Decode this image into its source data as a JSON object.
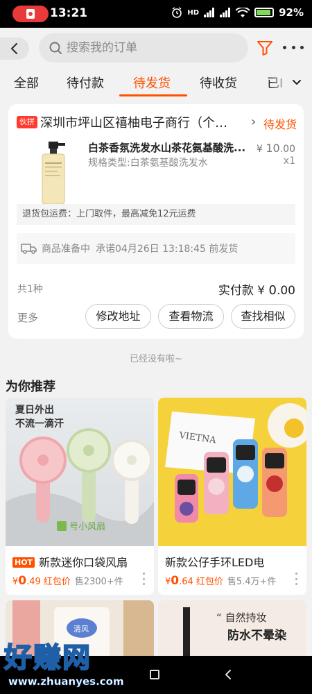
{
  "status_bar": {
    "time": "13:21",
    "signal_label": "HD",
    "battery_percent": "92%",
    "battery_level": 0.92
  },
  "header": {
    "search_placeholder": "搜索我的订单"
  },
  "tabs": [
    {
      "label": "全部",
      "active": false
    },
    {
      "label": "待付款",
      "active": false
    },
    {
      "label": "待发货",
      "active": true
    },
    {
      "label": "待收货",
      "active": false
    },
    {
      "label": "已I",
      "active": false
    }
  ],
  "order": {
    "shop_tag": "伙拼",
    "shop_name": "深圳市坪山区禧柚电子商行（个…",
    "status": "待发货",
    "product_title": "白茶香氛洗发水山茶花氨基酸洗...",
    "product_spec": "规格类型:白茶氨基酸洗发水",
    "price_symbol": "¥",
    "price_int": "10",
    "price_dec": ".00",
    "quantity": "x1",
    "return_notice": "退货包运费：上门取件，最高减免12元运费",
    "delivery_status": "商品准备中",
    "delivery_promise": "承诺04月26日 13:18:45 前发货",
    "item_count": "共1种",
    "paid_label": "实付款",
    "paid_symbol": "¥",
    "paid_int": "0",
    "paid_dec": ".00",
    "more_label": "更多",
    "actions": [
      "修改地址",
      "查看物流",
      "查找相似"
    ]
  },
  "end_note": "已经没有啦~",
  "recommend": {
    "title": "为你推荐",
    "items": [
      {
        "badge": "HOT",
        "name": "新款迷你口袋风扇",
        "price_symbol": "¥",
        "price": "0",
        "price_dec": ".49",
        "price_tag": "红包价",
        "sold": "售2300+件",
        "img_text_1": "夏日外出",
        "img_text_2": "不流一滴汗",
        "img_brand": "号小风扇"
      },
      {
        "badge": "",
        "name": "新款公仔手环LED电",
        "price_symbol": "¥",
        "price": "0",
        "price_dec": ".64",
        "price_tag": "红包价",
        "sold": "售5.4万+件",
        "img_text_1": "VIETNA"
      }
    ],
    "partial_items": [
      {
        "img_text": "清风"
      },
      {
        "img_text_1": "“ 自然持妆",
        "img_text_2": "防水不晕染"
      }
    ]
  },
  "watermark": {
    "text": "好赚网",
    "url": "www.zhuanyes.com"
  },
  "colors": {
    "accent": "#ff5000",
    "tag_red": "#ff3b2f",
    "status_bar": "#000000",
    "background": "#f2f2f2"
  }
}
